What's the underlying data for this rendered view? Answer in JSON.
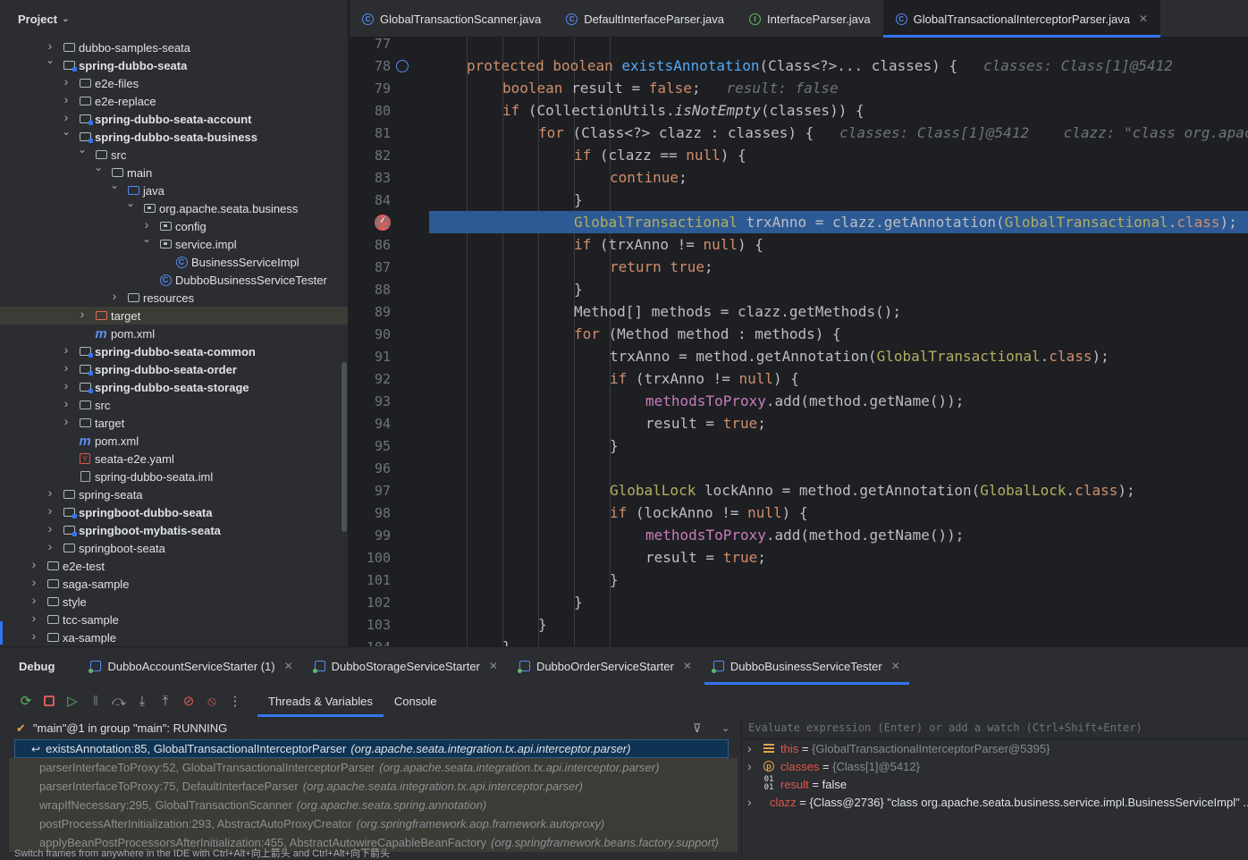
{
  "project": {
    "title": "Project",
    "tree": [
      {
        "label": "dubbo-samples-seata",
        "indent": 3,
        "arrow": "›",
        "icon": "folder",
        "bold": false
      },
      {
        "label": "spring-dubbo-seata",
        "indent": 3,
        "arrow": "⌄",
        "icon": "module",
        "bold": true
      },
      {
        "label": "e2e-files",
        "indent": 4,
        "arrow": "›",
        "icon": "folder",
        "bold": false
      },
      {
        "label": "e2e-replace",
        "indent": 4,
        "arrow": "›",
        "icon": "folder",
        "bold": false
      },
      {
        "label": "spring-dubbo-seata-account",
        "indent": 4,
        "arrow": "›",
        "icon": "module",
        "bold": true
      },
      {
        "label": "spring-dubbo-seata-business",
        "indent": 4,
        "arrow": "⌄",
        "icon": "module",
        "bold": true
      },
      {
        "label": "src",
        "indent": 5,
        "arrow": "⌄",
        "icon": "folder",
        "bold": false
      },
      {
        "label": "main",
        "indent": 6,
        "arrow": "⌄",
        "icon": "folder",
        "bold": false
      },
      {
        "label": "java",
        "indent": 7,
        "arrow": "⌄",
        "icon": "src",
        "bold": false
      },
      {
        "label": "org.apache.seata.business",
        "indent": 8,
        "arrow": "⌄",
        "icon": "pkg",
        "bold": false
      },
      {
        "label": "config",
        "indent": 9,
        "arrow": "›",
        "icon": "pkg",
        "bold": false
      },
      {
        "label": "service.impl",
        "indent": 9,
        "arrow": "⌄",
        "icon": "pkg",
        "bold": false
      },
      {
        "label": "BusinessServiceImpl",
        "indent": 10,
        "arrow": "",
        "icon": "class",
        "bold": false,
        "selected": true
      },
      {
        "label": "DubboBusinessServiceTester",
        "indent": 9,
        "arrow": "",
        "icon": "class",
        "bold": false
      },
      {
        "label": "resources",
        "indent": 7,
        "arrow": "›",
        "icon": "res",
        "bold": false
      },
      {
        "label": "target",
        "indent": 5,
        "arrow": "›",
        "icon": "target",
        "bold": false,
        "highlight": true
      },
      {
        "label": "pom.xml",
        "indent": 5,
        "arrow": "",
        "icon": "maven",
        "bold": false
      },
      {
        "label": "spring-dubbo-seata-common",
        "indent": 4,
        "arrow": "›",
        "icon": "module",
        "bold": true
      },
      {
        "label": "spring-dubbo-seata-order",
        "indent": 4,
        "arrow": "›",
        "icon": "module",
        "bold": true
      },
      {
        "label": "spring-dubbo-seata-storage",
        "indent": 4,
        "arrow": "›",
        "icon": "module",
        "bold": true
      },
      {
        "label": "src",
        "indent": 4,
        "arrow": "›",
        "icon": "folder",
        "bold": false
      },
      {
        "label": "target",
        "indent": 4,
        "arrow": "›",
        "icon": "folder",
        "bold": false
      },
      {
        "label": "pom.xml",
        "indent": 4,
        "arrow": "",
        "icon": "maven",
        "bold": false
      },
      {
        "label": "seata-e2e.yaml",
        "indent": 4,
        "arrow": "",
        "icon": "yaml",
        "bold": false
      },
      {
        "label": "spring-dubbo-seata.iml",
        "indent": 4,
        "arrow": "",
        "icon": "iml",
        "bold": false
      },
      {
        "label": "spring-seata",
        "indent": 3,
        "arrow": "›",
        "icon": "folder",
        "bold": false
      },
      {
        "label": "springboot-dubbo-seata",
        "indent": 3,
        "arrow": "›",
        "icon": "module",
        "bold": true
      },
      {
        "label": "springboot-mybatis-seata",
        "indent": 3,
        "arrow": "›",
        "icon": "module",
        "bold": true
      },
      {
        "label": "springboot-seata",
        "indent": 3,
        "arrow": "›",
        "icon": "folder",
        "bold": false
      },
      {
        "label": "e2e-test",
        "indent": 2,
        "arrow": "›",
        "icon": "folder",
        "bold": false
      },
      {
        "label": "saga-sample",
        "indent": 2,
        "arrow": "›",
        "icon": "folder",
        "bold": false
      },
      {
        "label": "style",
        "indent": 2,
        "arrow": "›",
        "icon": "folder",
        "bold": false
      },
      {
        "label": "tcc-sample",
        "indent": 2,
        "arrow": "›",
        "icon": "folder",
        "bold": false
      },
      {
        "label": "xa-sample",
        "indent": 2,
        "arrow": "›",
        "icon": "folder",
        "bold": false
      }
    ]
  },
  "editor_tabs": [
    {
      "label": "GlobalTransactionScanner.java",
      "icon": "class-icon",
      "active": false
    },
    {
      "label": "DefaultInterfaceParser.java",
      "icon": "class-icon",
      "active": false
    },
    {
      "label": "InterfaceParser.java",
      "icon": "interface-icon",
      "active": false
    },
    {
      "label": "GlobalTransactionalInterceptorParser.java",
      "icon": "class-icon",
      "active": true
    }
  ],
  "code_lines": [
    {
      "n": "77",
      "html": ""
    },
    {
      "n": "78",
      "html": "<span class='kw'>protected boolean </span><span class='fn'>existsAnnotation</span>(Class&lt;?&gt;... classes) {   <span class='hint'>classes: Class[1]@5412</span>",
      "indent": 1
    },
    {
      "n": "79",
      "html": "<span class='kw'>boolean </span>result = <span class='kw'>false</span>;   <span class='hint'>result: false</span>",
      "indent": 2
    },
    {
      "n": "80",
      "html": "<span class='kw'>if </span>(CollectionUtils.<span class='it'>isNotEmpty</span>(classes)) {",
      "indent": 2
    },
    {
      "n": "81",
      "html": "<span class='kw'>for </span>(Class&lt;?&gt; clazz : classes) {   <span class='hint'>classes: Class[1]@5412    clazz: \"class org.apache.seata.business.service.impl.BusinessServiceImpl\"</span>",
      "indent": 3
    },
    {
      "n": "82",
      "html": "<span class='kw'>if </span>(clazz == <span class='kw'>null</span>) {",
      "indent": 4
    },
    {
      "n": "83",
      "html": "<span class='kw'>continue</span>;",
      "indent": 5
    },
    {
      "n": "84",
      "html": "}",
      "indent": 4
    },
    {
      "n": "85",
      "html": "<span class='an'>GlobalTransactional</span> trxAnno = clazz.getAnnotation(<span class='an'>GlobalTransactional</span>.<span class='kw'>class</span>);",
      "indent": 4,
      "current": true
    },
    {
      "n": "86",
      "html": "<span class='kw'>if </span>(trxAnno != <span class='kw'>null</span>) {",
      "indent": 4
    },
    {
      "n": "87",
      "html": "<span class='kw'>return true</span>;",
      "indent": 5
    },
    {
      "n": "88",
      "html": "}",
      "indent": 4
    },
    {
      "n": "89",
      "html": "Method[] methods = clazz.getMethods();",
      "indent": 4
    },
    {
      "n": "90",
      "html": "<span class='kw'>for </span>(Method method : methods) {",
      "indent": 4
    },
    {
      "n": "91",
      "html": "trxAnno = method.getAnnotation(<span class='an'>GlobalTransactional</span>.<span class='kw'>class</span>);",
      "indent": 5
    },
    {
      "n": "92",
      "html": "<span class='kw'>if </span>(trxAnno != <span class='kw'>null</span>) {",
      "indent": 5
    },
    {
      "n": "93",
      "html": "<span class='fld'>methodsToProxy</span>.add(method.getName());",
      "indent": 6
    },
    {
      "n": "94",
      "html": "result = <span class='kw'>true</span>;",
      "indent": 6
    },
    {
      "n": "95",
      "html": "}",
      "indent": 5
    },
    {
      "n": "96",
      "html": "",
      "indent": 0
    },
    {
      "n": "97",
      "html": "<span class='an'>GlobalLock</span> lockAnno = method.getAnnotation(<span class='an'>GlobalLock</span>.<span class='kw'>class</span>);",
      "indent": 5
    },
    {
      "n": "98",
      "html": "<span class='kw'>if </span>(lockAnno != <span class='kw'>null</span>) {",
      "indent": 5
    },
    {
      "n": "99",
      "html": "<span class='fld'>methodsToProxy</span>.add(method.getName());",
      "indent": 6
    },
    {
      "n": "100",
      "html": "result = <span class='kw'>true</span>;",
      "indent": 6
    },
    {
      "n": "101",
      "html": "}",
      "indent": 5
    },
    {
      "n": "102",
      "html": "}",
      "indent": 4
    },
    {
      "n": "103",
      "html": "}",
      "indent": 3
    },
    {
      "n": "104",
      "html": "}",
      "indent": 2
    }
  ],
  "debug": {
    "title": "Debug",
    "sessions": [
      {
        "label": "DubboAccountServiceStarter (1)",
        "active": false
      },
      {
        "label": "DubboStorageServiceStarter",
        "active": false
      },
      {
        "label": "DubboOrderServiceStarter",
        "active": false
      },
      {
        "label": "DubboBusinessServiceTester",
        "active": true
      }
    ],
    "subtabs": [
      "Threads & Variables",
      "Console"
    ],
    "thread": "\"main\"@1 in group \"main\": RUNNING",
    "frames": [
      {
        "method": "existsAnnotation:85, GlobalTransactionalInterceptorParser",
        "pkg": "(org.apache.seata.integration.tx.api.interceptor.parser)",
        "current": true
      },
      {
        "method": "parserInterfaceToProxy:52, GlobalTransactionalInterceptorParser",
        "pkg": "(org.apache.seata.integration.tx.api.interceptor.parser)"
      },
      {
        "method": "parserInterfaceToProxy:75, DefaultInterfaceParser",
        "pkg": "(org.apache.seata.integration.tx.api.interceptor.parser)"
      },
      {
        "method": "wrapIfNecessary:295, GlobalTransactionScanner",
        "pkg": "(org.apache.seata.spring.annotation)"
      },
      {
        "method": "postProcessAfterInitialization:293, AbstractAutoProxyCreator",
        "pkg": "(org.springframework.aop.framework.autoproxy)"
      },
      {
        "method": "applyBeanPostProcessorsAfterInitialization:455, AbstractAutowireCapableBeanFactory",
        "pkg": "(org.springframework.beans.factory.support)"
      }
    ],
    "status": "Switch frames from anywhere in the IDE with Ctrl+Alt+向上箭头 and Ctrl+Alt+向下箭头",
    "eval_placeholder": "Evaluate expression (Enter) or add a watch (Ctrl+Shift+Enter)",
    "variables": [
      {
        "name": "this",
        "value": "{GlobalTransactionalInterceptorParser@5395}",
        "icon": "stack",
        "expand": true,
        "dim": true
      },
      {
        "name": "classes",
        "value": "{Class[1]@5412}",
        "icon": "param",
        "expand": true,
        "dim": true
      },
      {
        "name": "result",
        "value": "false",
        "icon": "prim",
        "expand": false,
        "dim": false
      },
      {
        "name": "clazz",
        "value": "{Class@2736} \"class org.apache.seata.business.service.impl.BusinessServiceImpl\" ...",
        "icon": "stack",
        "expand": true,
        "dim": false
      }
    ]
  }
}
